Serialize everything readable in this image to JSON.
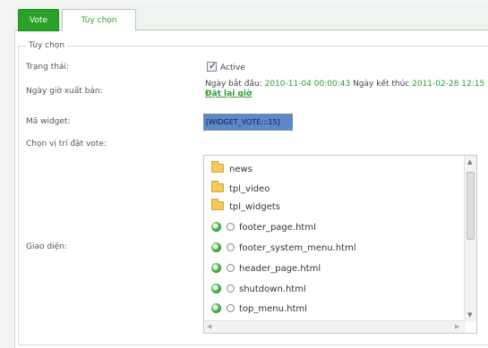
{
  "tabs": [
    {
      "label": "Vote",
      "active": false
    },
    {
      "label": "Tùy chọn",
      "active": true
    }
  ],
  "section": {
    "legend": "Tùy chọn"
  },
  "fields": {
    "status": {
      "label": "Trạng thái:",
      "checkbox_label": "Active",
      "checked": true
    },
    "publish": {
      "label": "Ngày giờ xuất bản:",
      "start_label": "Ngày bắt đầu:",
      "start_value": "2010-11-04 00:00:43",
      "end_label": "Ngày kết thúc",
      "end_value": "2011-02-28 12:15",
      "reset_link": "Đặt lại giờ"
    },
    "widget": {
      "label": "Mã widget:",
      "value": "[WIDGET_VOTE:::15]"
    },
    "position": {
      "label": "Chọn vị trí đặt vote:"
    },
    "template": {
      "label": "Giao diện:"
    }
  },
  "tree": {
    "folders": [
      "news",
      "tpl_video",
      "tpl_widgets"
    ],
    "files": [
      "footer_page.html",
      "footer_system_menu.html",
      "header_page.html",
      "shutdown.html",
      "top_menu.html"
    ]
  },
  "icons": {
    "folder": "folder-icon",
    "file": "html-file-icon",
    "scroll_up": "▲",
    "scroll_down": "▼",
    "scroll_left": "◀",
    "scroll_right": "▶"
  },
  "colors": {
    "accent": "#2aa22a",
    "link": "#2e9a2e",
    "selection": "#5b89c9"
  }
}
